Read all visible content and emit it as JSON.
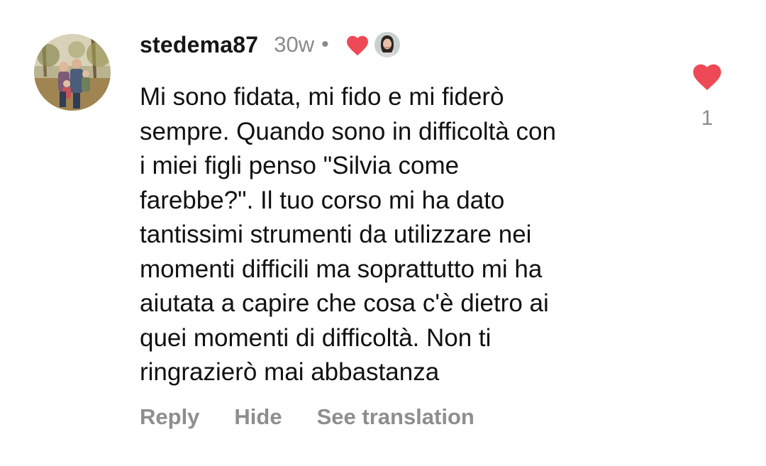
{
  "comment": {
    "username": "stedema87",
    "timestamp": "30w",
    "separator": "•",
    "text": "Mi sono fidata, mi fido e mi fiderò\nsempre. Quando sono in difficoltà con\ni miei figli penso \"Silvia come\nfarebbe?\". Il tuo corso mi ha dato\ntantissimi strumenti da utilizzare nei\nmomenti difficili ma soprattutto mi ha\naiutata a capire che cosa c'è dietro ai\nquei momenti di difficoltà. Non ti\nringrazierò mai abbastanza",
    "creator_liked_icon": "heart-filled-icon",
    "like_count": "1"
  },
  "actions": {
    "reply": "Reply",
    "hide": "Hide",
    "see_translation": "See translation"
  },
  "colors": {
    "heart_red": "#ED4956",
    "secondary_text": "#8E8E8E",
    "primary_text": "#111111"
  }
}
